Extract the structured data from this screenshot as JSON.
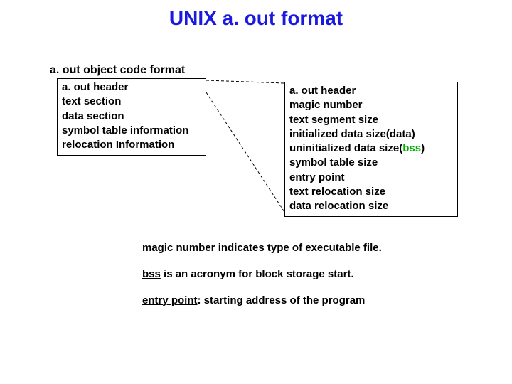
{
  "title": "UNIX a. out format",
  "subtitle": "a. out object code format",
  "left_box": {
    "l1": "a. out header",
    "l2": "text section",
    "l3": "data section",
    "l4": "symbol table information",
    "l5": "relocation Information"
  },
  "right_box": {
    "l1": "a. out header",
    "l2": "magic number",
    "l3": "text segment size",
    "l4_pre": "initialized data size(",
    "l4_accent": "data",
    "l4_post": ")",
    "l5_pre": "uninitialized data size(",
    "l5_accent": "bss",
    "l5_post": ")",
    "l6": "symbol table size",
    "l7": "entry point",
    "l8": "text relocation size",
    "l9": "data relocation size"
  },
  "notes": {
    "n1_term": "magic number",
    "n1_rest": " indicates type of executable file.",
    "n2_term": "bss",
    "n2_rest": " is an acronym for block storage start.",
    "n3_term": "entry point",
    "n3_rest": ": starting address of the program"
  }
}
